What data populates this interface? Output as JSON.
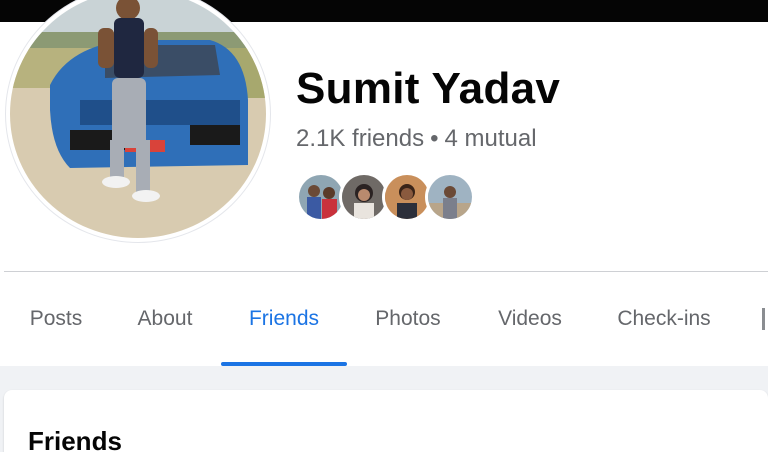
{
  "profile": {
    "name": "Sumit Yadav",
    "friends_count": "2.1K friends",
    "separator": "•",
    "mutual": "4 mutual"
  },
  "tabs": [
    {
      "label": "Posts",
      "active": false
    },
    {
      "label": "About",
      "active": false
    },
    {
      "label": "Friends",
      "active": true
    },
    {
      "label": "Photos",
      "active": false
    },
    {
      "label": "Videos",
      "active": false
    },
    {
      "label": "Check-ins",
      "active": false
    }
  ],
  "friends_section": {
    "heading": "Friends"
  },
  "colors": {
    "accent": "#1b74e4",
    "secondary_text": "#65676b",
    "primary_text": "#050505"
  }
}
